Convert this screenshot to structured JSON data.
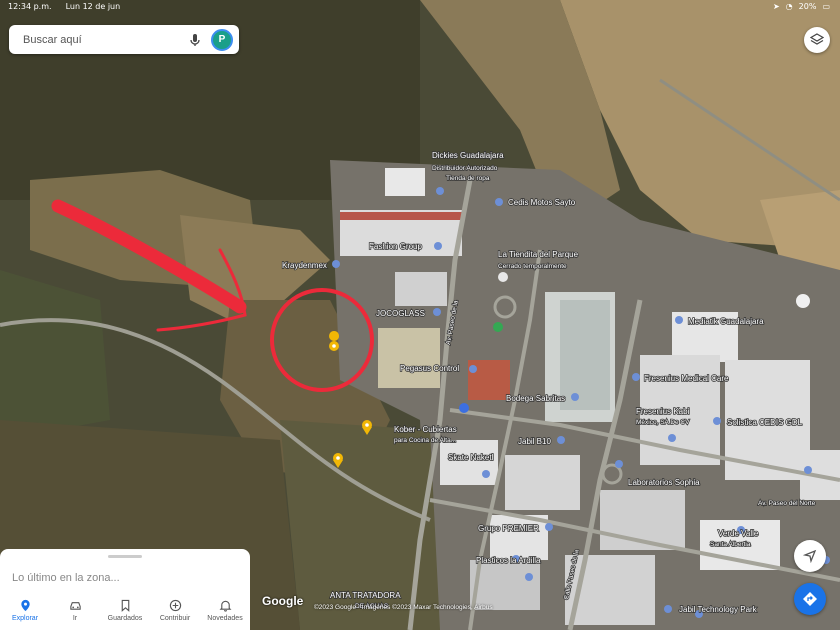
{
  "status_bar": {
    "time": "12:34 p.m.",
    "date": "Lun 12 de jun",
    "battery": "20%"
  },
  "search": {
    "placeholder": "Buscar aquí",
    "avatar_letter": "P"
  },
  "places": [
    {
      "name": "Dickies Guadalajara",
      "sub1": "Distribuidor Autorizado",
      "sub2": "Tienda de ropa"
    },
    {
      "name": "Cedis Motos Sayto"
    },
    {
      "name": "Fashion Group"
    },
    {
      "name": "Kraydenmex"
    },
    {
      "name": "La Tiendita del Parque",
      "sub1": "Cerrado temporalmente"
    },
    {
      "name": "Mediatik Guadalajara"
    },
    {
      "name": "JOCOGLASS"
    },
    {
      "name": "Pegasus Control"
    },
    {
      "name": "Fresenius Medical Care"
    },
    {
      "name": "Bodega Sabritas"
    },
    {
      "name": "Fresenius Kabi",
      "sub1": "México, SA De CV"
    },
    {
      "name": "Solistica CEDIS GDL"
    },
    {
      "name": "Kober - Cubiertas",
      "sub1": "para Cocina de Alta..."
    },
    {
      "name": "Jabil B10"
    },
    {
      "name": "Skate Naketl"
    },
    {
      "name": "Laboratorios Sophia"
    },
    {
      "name": "Grupo PREMIER"
    },
    {
      "name": "Verde Valle",
      "sub1": "Santa Albertia"
    },
    {
      "name": "Plasticos la Ardilla"
    },
    {
      "name": "Jabil Technology Park"
    },
    {
      "name": "ANTA TRATADORA",
      "sub1": "DE AGUAS"
    }
  ],
  "roads": [
    {
      "name": "Av. Paseo del Norte"
    },
    {
      "name": "Av. Paseo de la"
    },
    {
      "name": "Calle Paseo de la"
    }
  ],
  "map_footer": {
    "logo": "Google",
    "attribution": "©2023 Google · Imágenes ©2023 Maxar Technologies, Airbus"
  },
  "bottom_sheet": {
    "title": "Lo último en la zona..."
  },
  "nav_tabs": [
    {
      "label": "Explorar",
      "icon": "pin-icon",
      "active": true
    },
    {
      "label": "Ir",
      "icon": "car-icon",
      "active": false
    },
    {
      "label": "Guardados",
      "icon": "bookmark-icon",
      "active": false
    },
    {
      "label": "Contribuir",
      "icon": "plus-circle-icon",
      "active": false
    },
    {
      "label": "Novedades",
      "icon": "bell-icon",
      "active": false
    }
  ],
  "colors": {
    "accent": "#1a73e8",
    "annotation": "#ec2a3a",
    "pin_yellow": "#f2b705"
  }
}
